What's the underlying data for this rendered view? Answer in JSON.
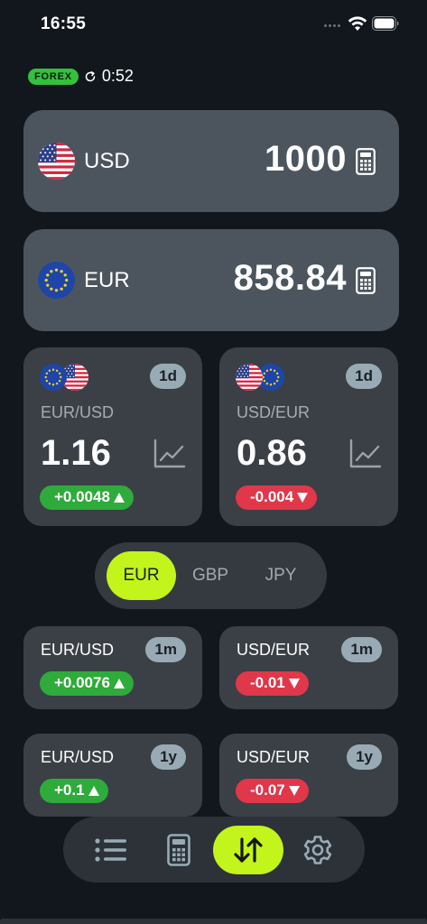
{
  "status_bar": {
    "time": "16:55"
  },
  "forex": {
    "badge": "FOREX",
    "timer": "0:52"
  },
  "converter": [
    {
      "code": "USD",
      "value": "1000",
      "flag": "us-flag"
    },
    {
      "code": "EUR",
      "value": "858.84",
      "flag": "eu-flag"
    }
  ],
  "rate_cards": [
    {
      "pair": "EUR/USD",
      "period": "1d",
      "rate": "1.16",
      "change": "+0.0048",
      "direction": "up"
    },
    {
      "pair": "USD/EUR",
      "period": "1d",
      "rate": "0.86",
      "change": "-0.004",
      "direction": "down"
    }
  ],
  "segment": {
    "options": [
      "EUR",
      "GBP",
      "JPY"
    ],
    "selected": "EUR"
  },
  "mini_cards": [
    {
      "pair": "EUR/USD",
      "period": "1m",
      "change": "+0.0076",
      "direction": "up"
    },
    {
      "pair": "USD/EUR",
      "period": "1m",
      "change": "-0.01",
      "direction": "down"
    },
    {
      "pair": "EUR/USD",
      "period": "1y",
      "change": "+0.1",
      "direction": "up"
    },
    {
      "pair": "USD/EUR",
      "period": "1y",
      "change": "-0.07",
      "direction": "down"
    }
  ],
  "tabbar": {
    "icons": [
      "list-icon",
      "calculator-icon",
      "exchange-arrows-icon",
      "gear-icon"
    ],
    "active": "exchange-arrows-icon"
  },
  "colors": {
    "background": "#12171d",
    "accent": "#c3f41b",
    "up": "#2eab3a",
    "down": "#e0374a",
    "forex_badge": "#33c13c"
  }
}
